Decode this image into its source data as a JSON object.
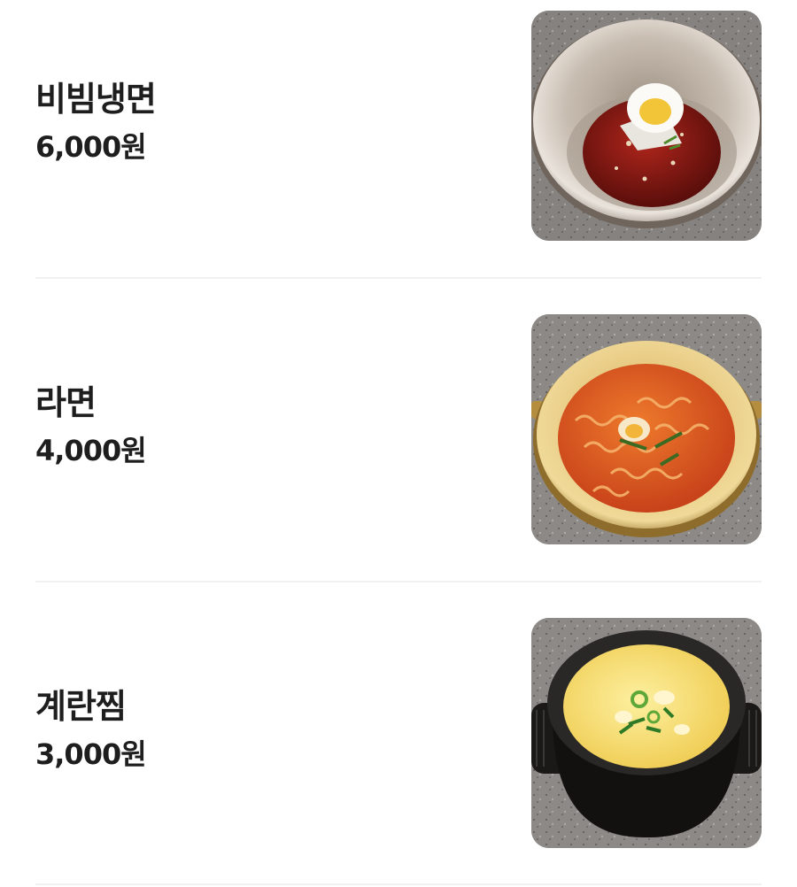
{
  "menu": {
    "items": [
      {
        "name": "비빔냉면",
        "price": "6,000원",
        "image": "bibim-naengmyeon-photo"
      },
      {
        "name": "라면",
        "price": "4,000원",
        "image": "ramyeon-photo"
      },
      {
        "name": "계란찜",
        "price": "3,000원",
        "image": "steamed-egg-photo"
      }
    ]
  }
}
